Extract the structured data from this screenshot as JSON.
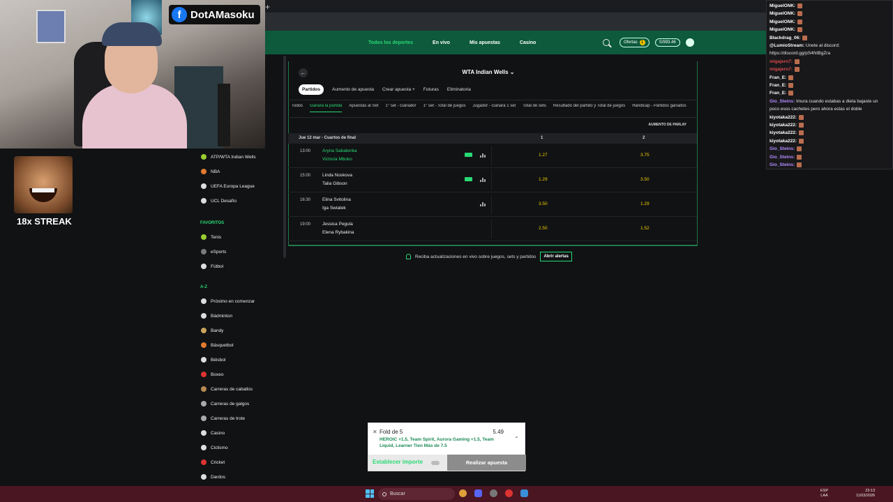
{
  "stream": {
    "channel_name": "DotAMasoku",
    "emote_caption": "18x STREAK"
  },
  "app": {
    "nav": [
      "Todos los deportes",
      "En vivo",
      "Mis apuestas",
      "Casino"
    ],
    "nav_active": 0,
    "ofertas_label": "Ofertas",
    "ofertas_count": "1",
    "balance": "S/993.46"
  },
  "sidebar": {
    "top_items": [
      {
        "label": "ATP/WTA Indian Wells",
        "color": "#9acd32"
      },
      {
        "label": "NBA",
        "color": "#e07a2e"
      },
      {
        "label": "UEFA Europa League",
        "color": "#dddddd"
      },
      {
        "label": "UCL Desafío",
        "color": "#dddddd"
      }
    ],
    "favoritos_header": "FAVORITOS",
    "favoritos": [
      {
        "label": "Tenis",
        "color": "#9acd32"
      },
      {
        "label": "eSports",
        "color": "#7a7a7a"
      },
      {
        "label": "Fútbol",
        "color": "#dddddd"
      }
    ],
    "az_header": "A-Z",
    "az_items": [
      {
        "label": "Próximo en comenzar",
        "color": "#dddddd"
      },
      {
        "label": "Bádminton",
        "color": "#dddddd"
      },
      {
        "label": "Bandy",
        "color": "#c9a35a"
      },
      {
        "label": "Básquetbol",
        "color": "#e07a2e"
      },
      {
        "label": "Béisbol",
        "color": "#dddddd"
      },
      {
        "label": "Boxeo",
        "color": "#d33"
      },
      {
        "label": "Carreras de caballos",
        "color": "#b58a52"
      },
      {
        "label": "Carreras de galgos",
        "color": "#aaaaaa"
      },
      {
        "label": "Carreras de trote",
        "color": "#aaaaaa"
      },
      {
        "label": "Casino",
        "color": "#dddddd"
      },
      {
        "label": "Ciclismo",
        "color": "#dddddd"
      },
      {
        "label": "Cricket",
        "color": "#d33"
      },
      {
        "label": "Dardos",
        "color": "#dddddd"
      }
    ]
  },
  "event": {
    "title": "WTA Indian Wells ⌄",
    "tabs": [
      "Partidos",
      "Aumento de apuesta",
      "Crear apuesta +",
      "Futuras",
      "Eliminatoria"
    ],
    "markets": [
      "Todos",
      "Ganará la partida",
      "Apuestas al Set",
      "1° set - Ganador",
      "1° set - Total de juegos",
      "Jugador - Ganará 1 set",
      "Total de sets",
      "Resultado del partido y Total de juegos",
      "Hándicap - Partidos ganados"
    ],
    "market_active": 1,
    "parlay_label": "AUMENTO DE PARLAY",
    "date_label": "Jue 12 mar - Cuartos de final",
    "col1": "1",
    "col2": "2",
    "matches": [
      {
        "time": "13:00",
        "p1": "Aryna Sabalenka",
        "p2": "Victoria Mboko",
        "odd1": "1.27",
        "odd2": "3.75",
        "fav": true,
        "badge": true,
        "stats": true
      },
      {
        "time": "15:00",
        "p1": "Linda Noskova",
        "p2": "Talia Gibson",
        "odd1": "1.29",
        "odd2": "3.50",
        "fav": false,
        "badge": true,
        "stats": true
      },
      {
        "time": "16:30",
        "p1": "Elina Svitolina",
        "p2": "Iga Swiatek",
        "odd1": "3.50",
        "odd2": "1.29",
        "fav": false,
        "badge": false,
        "stats": true
      },
      {
        "time": "19:00",
        "p1": "Jessica Pegula",
        "p2": "Elena Rybakina",
        "odd1": "2.50",
        "odd2": "1.52",
        "fav": false,
        "badge": false,
        "stats": false
      }
    ],
    "alert_text": "Reciba actualizaciones en vivo sobre juegos, sets y partidos",
    "alert_button": "Abrir alertas"
  },
  "betslip": {
    "title": "Fold de 5",
    "odds": "5.49",
    "legs": "HEROIC +1.5, Team Spirit, Aurora Gaming +1.5, Team Liquid, Learner Tien Más de 7.5",
    "stake_label": "Establecer importe",
    "place_label": "Realizar apuesta"
  },
  "chat": [
    {
      "user": "MiguelONK:",
      "text": "",
      "color": "#ffffff",
      "emote": true
    },
    {
      "user": "MiguelONK:",
      "text": "",
      "color": "#ffffff",
      "emote": true
    },
    {
      "user": "MiguelONK:",
      "text": "",
      "color": "#ffffff",
      "emote": true
    },
    {
      "user": "MiguelONK:",
      "text": "",
      "color": "#ffffff",
      "emote": true
    },
    {
      "user": "Blackdrag_06:",
      "text": "",
      "color": "#ffffff",
      "emote": true
    },
    {
      "user": "@LumioStream:",
      "text": "Únete al discord:",
      "color": "#ffffff",
      "emote": false
    },
    {
      "user": "",
      "text": "https://discord.gg/pS4NtBgZra",
      "color": "#ffffff",
      "emote": false
    },
    {
      "user": "migajero7:",
      "text": "",
      "color": "#d94a4a",
      "emote": true
    },
    {
      "user": "migajero7:",
      "text": "",
      "color": "#d94a4a",
      "emote": true
    },
    {
      "user": "Fran_E:",
      "text": "",
      "color": "#ffffff",
      "emote": true
    },
    {
      "user": "Fran_E:",
      "text": "",
      "color": "#ffffff",
      "emote": true
    },
    {
      "user": "Fran_E:",
      "text": "",
      "color": "#ffffff",
      "emote": true
    },
    {
      "user": "Gio_Steins:",
      "text": "Imura cuando estabas a dieta bajaste un",
      "color": "#b48cff",
      "emote": false
    },
    {
      "user": "",
      "text": "poco esos cachetes pero ahora estas el doble",
      "color": "#ffffff",
      "emote": false
    },
    {
      "user": "kiyotaka222:",
      "text": "",
      "color": "#ffffff",
      "emote": true
    },
    {
      "user": "kiyotaka222:",
      "text": "",
      "color": "#ffffff",
      "emote": true
    },
    {
      "user": "kiyotaka222:",
      "text": "",
      "color": "#ffffff",
      "emote": true
    },
    {
      "user": "kiyotaka222:",
      "text": "",
      "color": "#ffffff",
      "emote": true
    },
    {
      "user": "Gio_Steins:",
      "text": "",
      "color": "#b48cff",
      "emote": true
    },
    {
      "user": "Gio_Steins:",
      "text": "",
      "color": "#b48cff",
      "emote": true
    },
    {
      "user": "Gio_Steins:",
      "text": "",
      "color": "#b48cff",
      "emote": true
    }
  ],
  "taskbar": {
    "search_label": "Buscar",
    "lang_top": "ESP",
    "lang_bottom": "LAA",
    "time": "23:13",
    "date": "11/03/2026"
  }
}
